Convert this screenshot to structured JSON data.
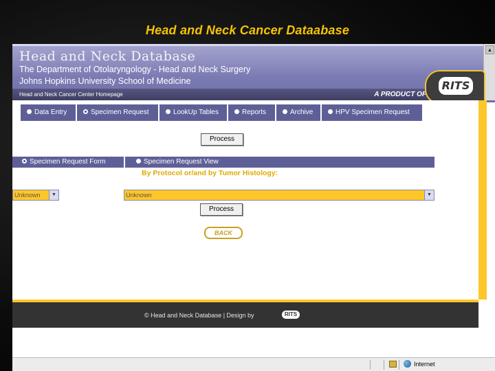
{
  "slide_title": "Head and Neck Cancer Dataabase",
  "header": {
    "title": "Head and Neck Database",
    "department": "The Department of Otolaryngology - Head and Neck Surgery",
    "school": "Johns Hopkins University School of Medicine",
    "home_link": "Head and Neck Cancer Center Homepage",
    "product_of": "A PRODUCT OF",
    "logo_text": "RITS"
  },
  "tabs": [
    {
      "label": "Data Entry",
      "selected": false
    },
    {
      "label": "Specimen Request",
      "selected": true
    },
    {
      "label": "LookUp Tables",
      "selected": false
    },
    {
      "label": "Reports",
      "selected": false
    },
    {
      "label": "Archive",
      "selected": false
    },
    {
      "label": "HPV Specimen Request",
      "selected": false
    }
  ],
  "process_label_1": "Process",
  "subtabs": [
    {
      "label": "Specimen Request Form",
      "selected": true
    },
    {
      "label": "Specimen Request View",
      "selected": false
    }
  ],
  "filter_heading": "By Protocol or/and by Tumor Histology:",
  "protocol_select": {
    "value": "Unknown"
  },
  "histology_select": {
    "value": "Unknown"
  },
  "process_label_2": "Process",
  "back_label": "BACK",
  "footer": {
    "text": "© Head and Neck Database | Design by",
    "logo_text": "RITS"
  },
  "status": {
    "zone": "Internet"
  },
  "colors": {
    "accent": "#fdc72a",
    "nav": "#5f5f98",
    "title": "#f6c400"
  }
}
